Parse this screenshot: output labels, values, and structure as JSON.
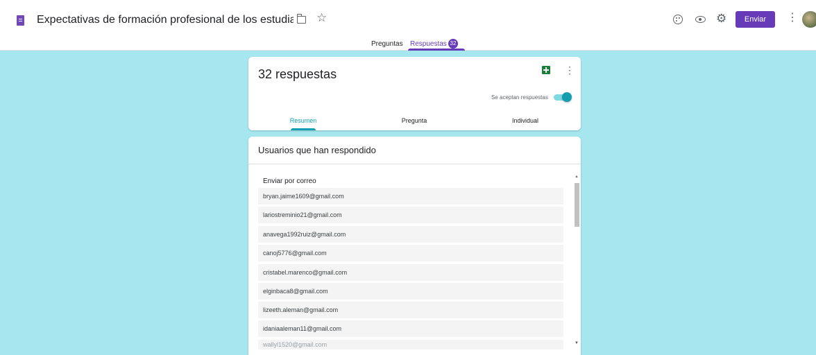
{
  "header": {
    "doc_title": "Expectativas de formación profesional de los estudiantes de",
    "send_label": "Enviar",
    "icons": [
      "form-icon",
      "folder-icon",
      "star-icon",
      "palette-icon",
      "eye-icon",
      "gear-icon",
      "more-vert-icon",
      "avatar"
    ]
  },
  "top_tabs": {
    "questions_label": "Preguntas",
    "responses_label": "Respuestas",
    "responses_count": "32"
  },
  "summary_card": {
    "title": "32 respuestas",
    "accepting_label": "Se aceptan respuestas",
    "accepting": true,
    "tabs": {
      "summary": "Resumen",
      "question": "Pregunta",
      "individual": "Individual"
    },
    "active_tab": "Resumen"
  },
  "respondents_card": {
    "title": "Usuarios que han respondido",
    "list_heading": "Enviar por correo",
    "emails": [
      "bryan.jaime1609@gmail.com",
      "lariostreminio21@gmail.com",
      "anavega1992ruiz@gmail.com",
      "canoj5776@gmail.com",
      "cristabel.marenco@gmail.com",
      "elginbaca8@gmail.com",
      "lizeeth.aleman@gmail.com",
      "idaniaaleman11@gmail.com",
      "wallyl1520@gmail.com"
    ]
  },
  "colors": {
    "accent": "#673ab7",
    "teal": "#129eaf",
    "background": "#a6e6ee"
  }
}
